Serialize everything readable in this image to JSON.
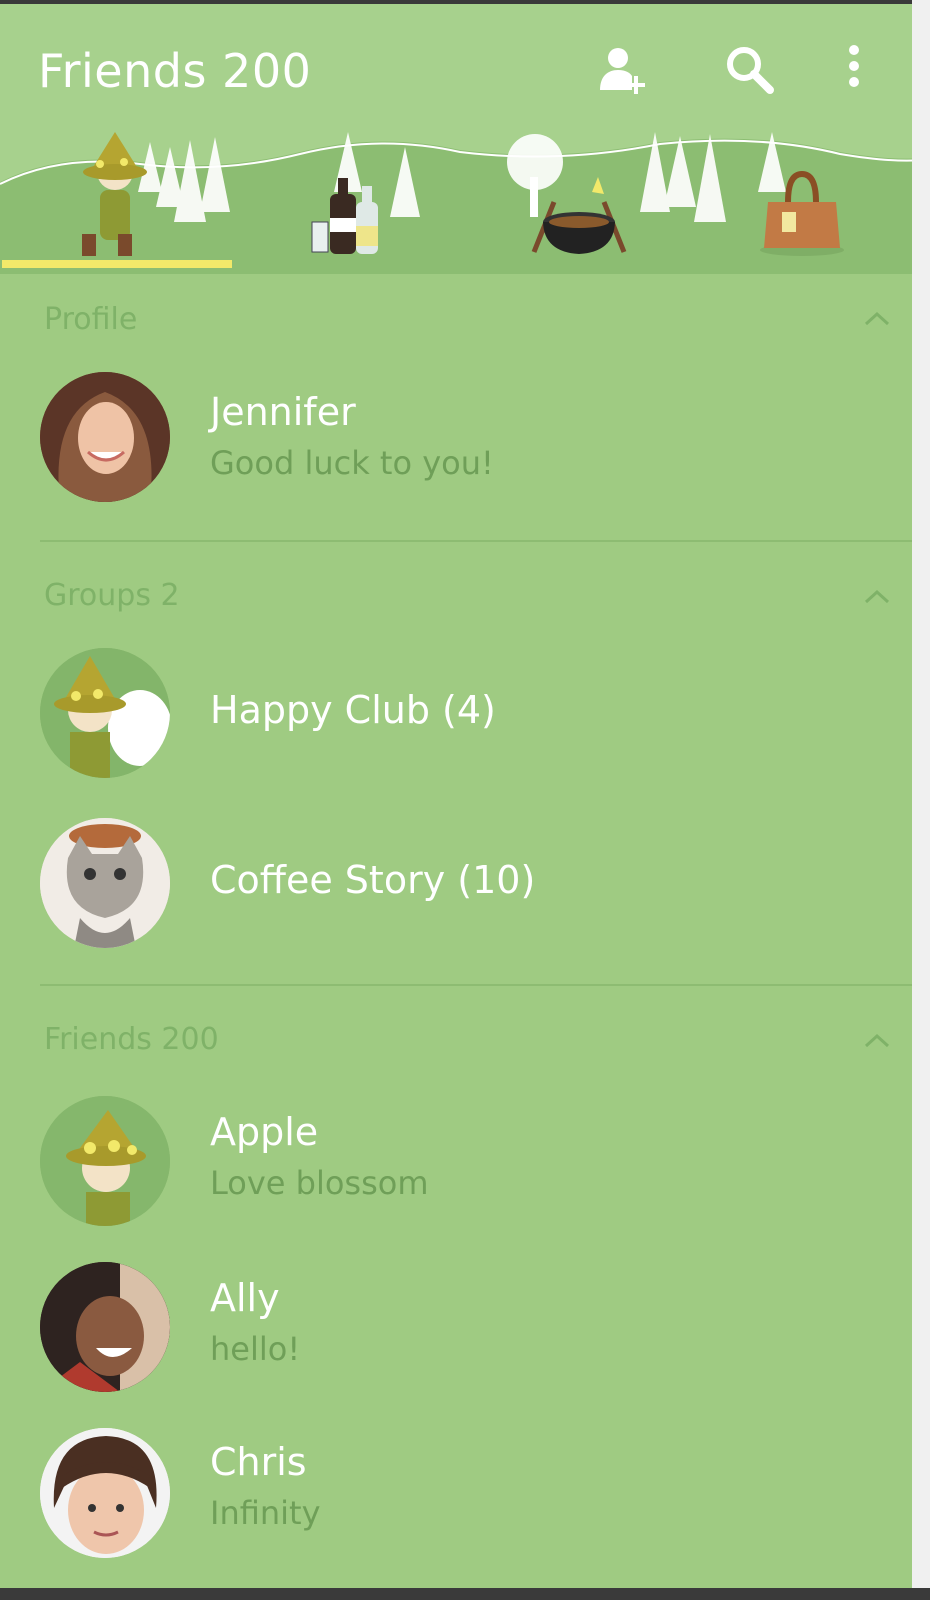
{
  "header": {
    "title": "Friends 200",
    "icons": [
      "add-friend-icon",
      "search-icon",
      "more-vertical-icon"
    ]
  },
  "tabs": [
    {
      "icon": "character-icon",
      "active": true
    },
    {
      "icon": "bottles-icon",
      "active": false
    },
    {
      "icon": "cooking-pot-icon",
      "active": false
    },
    {
      "icon": "bag-icon",
      "active": false
    }
  ],
  "sections": {
    "profile": {
      "label": "Profile",
      "user": {
        "name": "Jennifer",
        "status": "Good luck to you!"
      }
    },
    "groups": {
      "label": "Groups 2",
      "items": [
        {
          "name": "Happy Club (4)"
        },
        {
          "name": "Coffee Story (10)"
        }
      ]
    },
    "friends": {
      "label": "Friends 200",
      "items": [
        {
          "name": "Apple",
          "status": "Love blossom"
        },
        {
          "name": "Ally",
          "status": "hello!"
        },
        {
          "name": "Chris",
          "status": "Infinity"
        }
      ]
    }
  },
  "colors": {
    "background": "#9fcb82",
    "header": "#a7d18d",
    "accent": "#f2e96a"
  }
}
